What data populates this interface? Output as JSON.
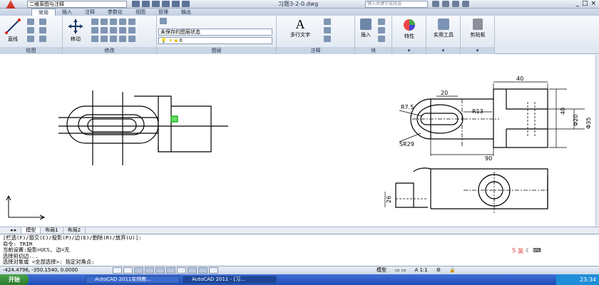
{
  "title_bar": {
    "workspace": "二维草图与注释",
    "document": "习题3-2-0.dwg",
    "search_placeholder": "键入关键字或短语",
    "window_buttons": [
      "_",
      "□",
      "×"
    ]
  },
  "ribbon_tabs": [
    "常用",
    "插入",
    "注释",
    "参数化",
    "视图",
    "管理",
    "输出"
  ],
  "ribbon": {
    "draw": {
      "line_label": "直线",
      "title": "绘图"
    },
    "modify": {
      "move_label": "移动",
      "title": "修改"
    },
    "layers": {
      "layer_state": "未保存的图层状态",
      "current_layer": "0",
      "title": "图层"
    },
    "annotation": {
      "text_label": "多行文字",
      "title": "注释"
    },
    "block": {
      "insert_label": "插入",
      "title": "块"
    },
    "properties_label": "特性",
    "utilities_label": "实用工具",
    "clipboard_label": "剪贴板"
  },
  "layout_tabs": [
    "模型",
    "布局1",
    "布局2"
  ],
  "dimensions": {
    "d40": "40",
    "d20": "20",
    "r75": "R7.5",
    "r13": "R13",
    "sr29": "SR29",
    "d90": "90",
    "d40v": "40",
    "phi20": "Φ20",
    "phi35": "Φ35",
    "d26": "26"
  },
  "command_lines": [
    "[栏选(F)/窗交(C)/投影(P)/边(E)/删除(R)/放弃(U)]:",
    "命令:  TRIM",
    "当前设置:投影=UCS, 边=无",
    "选择剪切边...",
    "选择对象或 <全部选择>:  指定对角点:"
  ],
  "status_bar": {
    "coordinates": "-424.4796, -350.1540, 0.0000",
    "model_label": "模型",
    "scale": "A 1:1",
    "ime_label": "英"
  },
  "taskbar": {
    "start_label": "开始",
    "items": [
      "AutoCAD 2011实例教...",
      "AutoCAD 2011 - [习..."
    ],
    "clock": "23:34"
  }
}
